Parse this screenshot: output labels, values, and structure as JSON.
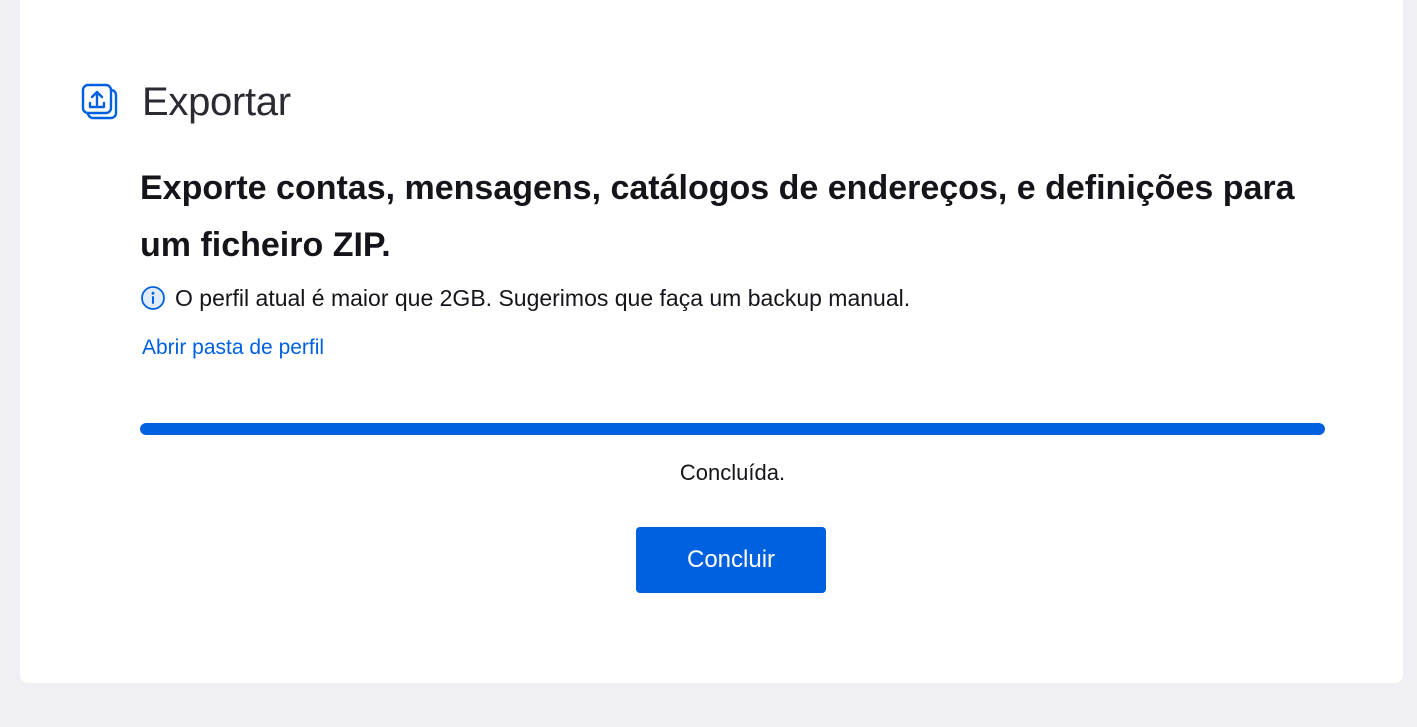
{
  "header": {
    "icon": "export-icon",
    "title": "Exportar"
  },
  "main": {
    "headline": "Exporte contas, mensagens, catálogos de endereços, e definições para um ficheiro ZIP.",
    "info": {
      "icon": "info-icon",
      "text": "O perfil atual é maior que 2GB. Sugerimos que faça um backup manual."
    },
    "open_profile_link": "Abrir pasta de perfil",
    "progress": {
      "percent": 100,
      "status": "Concluída."
    },
    "finish_button": "Concluir"
  },
  "colors": {
    "accent": "#0061e0",
    "link": "#0060df",
    "page_background": "#f0f0f4",
    "card_background": "#ffffff"
  }
}
